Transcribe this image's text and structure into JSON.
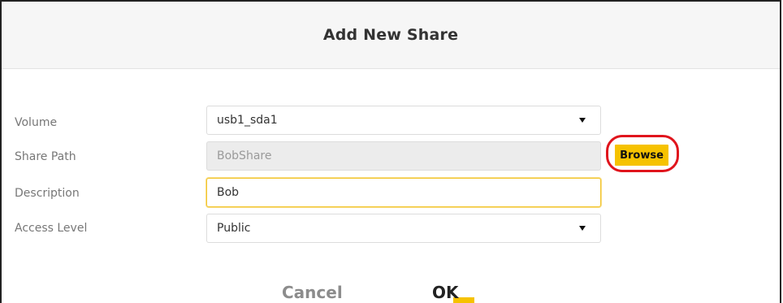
{
  "dialog": {
    "title": "Add New Share"
  },
  "form": {
    "volume": {
      "label": "Volume",
      "value": "usb1_sda1"
    },
    "share_path": {
      "label": "Share Path",
      "value": "BobShare",
      "browse_label": "Browse"
    },
    "description": {
      "label": "Description",
      "value": "Bob"
    },
    "access_level": {
      "label": "Access Level",
      "value": "Public"
    }
  },
  "footer": {
    "cancel_label": "Cancel",
    "ok_label": "OK"
  },
  "colors": {
    "accent": "#f6c200",
    "highlight": "#e0141c"
  },
  "icons": {
    "dropdown": "chevron-down-icon"
  }
}
